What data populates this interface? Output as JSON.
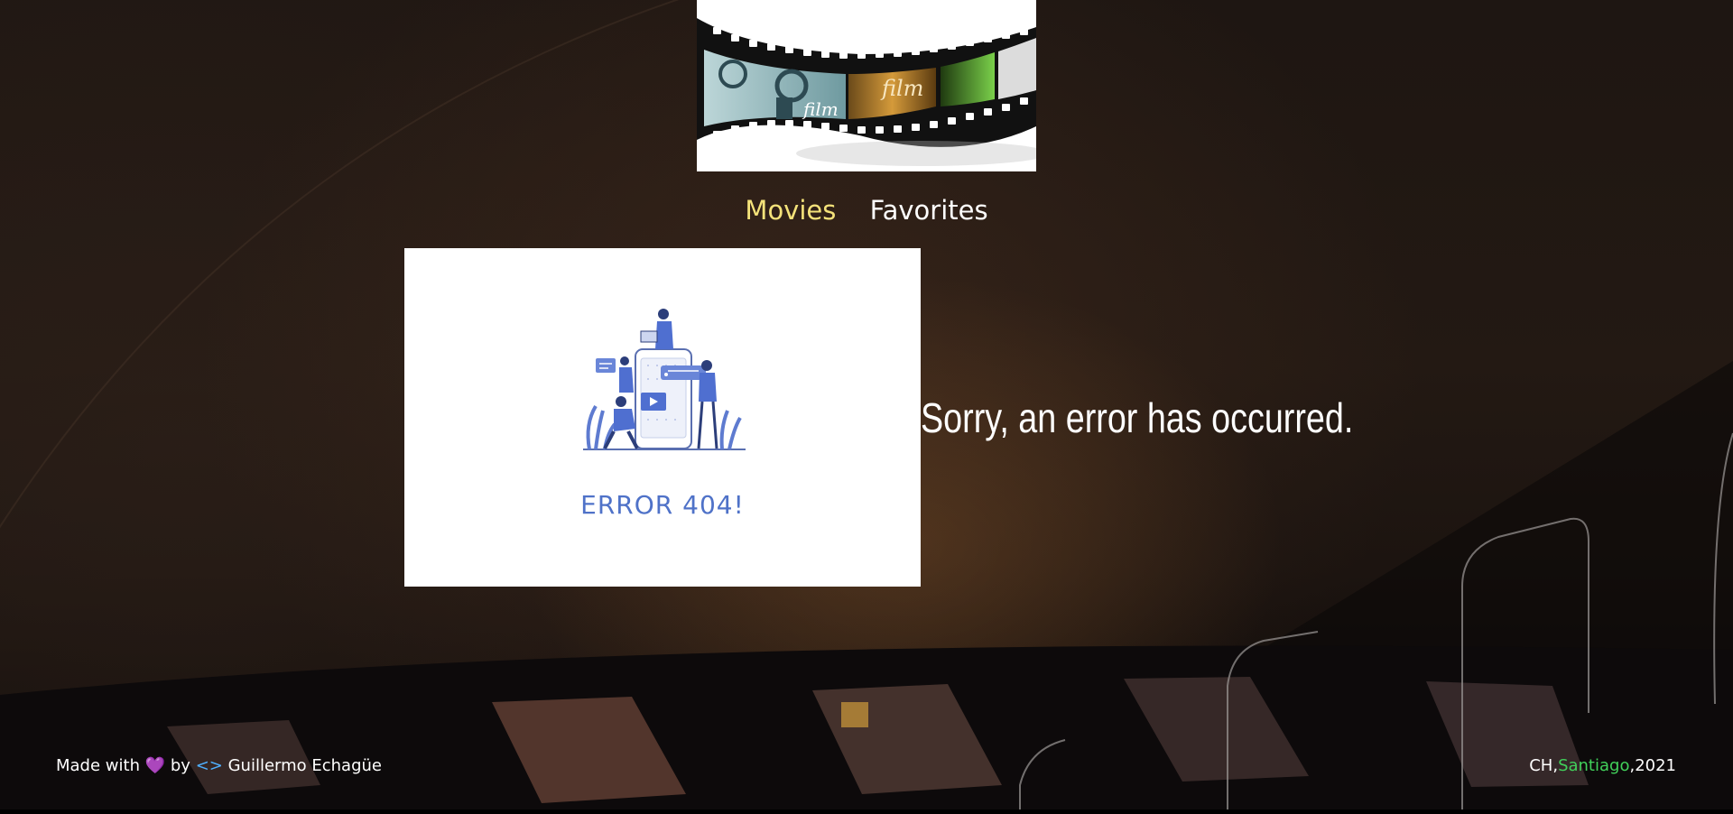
{
  "nav": {
    "movies": "Movies",
    "favorites": "Favorites",
    "active_color": "#f4e27a"
  },
  "logo": {
    "film_text": "film"
  },
  "error": {
    "image_caption": "ERROR 404!",
    "message": "Sorry, an error has occurred."
  },
  "footer": {
    "made_with": "Made with",
    "heart_icon": "heart-icon",
    "by": "by",
    "code_symbol": "<>",
    "author": "Guillermo Echagüe",
    "country": "CH,",
    "city": "Santiago",
    "year": ",2021",
    "city_color": "#41d05a"
  }
}
